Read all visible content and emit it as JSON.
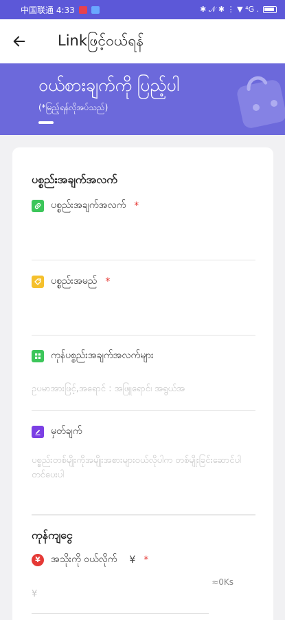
{
  "status_bar": {
    "carrier_time": "中国联通 4:33",
    "right_text": "✱ 𝒩 ✱ ⋮ ▼ ⁴G ."
  },
  "app_bar": {
    "title": "Linkဖြင့်ဝယ်ရန်"
  },
  "banner": {
    "title": "ဝယ်စားချက်ကို ပြည့်ပါ",
    "subtitle": "(*မြည့်ရန်လိုအပ်သည်)"
  },
  "product_section": {
    "title": "ပစ္စည်းအချက်အလက်",
    "fields": [
      {
        "label": "ပစ္စည်းအချက်အလက်",
        "required": "*",
        "value": "",
        "icon": "link-icon",
        "color": "#3cc65a"
      },
      {
        "label": "ပစ္စည်းအမည်",
        "required": "*",
        "value": "",
        "icon": "tag-icon",
        "color": "#f5c02c"
      },
      {
        "label": "ကုန်ပစ္စည်းအချက်အလက်များ",
        "required": "",
        "value": "ဥပမာအားဖြင့်,အရောင် : အဖြူရောင်၊ အရွယ်အ",
        "icon": "grid-icon",
        "color": "#3cc65a"
      },
      {
        "label": "မှတ်ချက်",
        "required": "",
        "value": "ပစ္စည်းတစ်မျိုးကိုအမျိုးအစားများဝယ်လိုပါက တစ်မျိုးခြင်းဆောင်ပါတင်ပေးပါ",
        "icon": "edit-icon",
        "color": "#7b3fe4"
      }
    ]
  },
  "price_section": {
    "title": "ကုန်ကျငွေ",
    "field": {
      "label": "အသိုးကို ဝယ်လိုက်",
      "currency": "¥",
      "required": "*",
      "placeholder": "¥",
      "hint": "≈0Ks",
      "icon": "yen-icon",
      "color": "#e53935"
    }
  }
}
